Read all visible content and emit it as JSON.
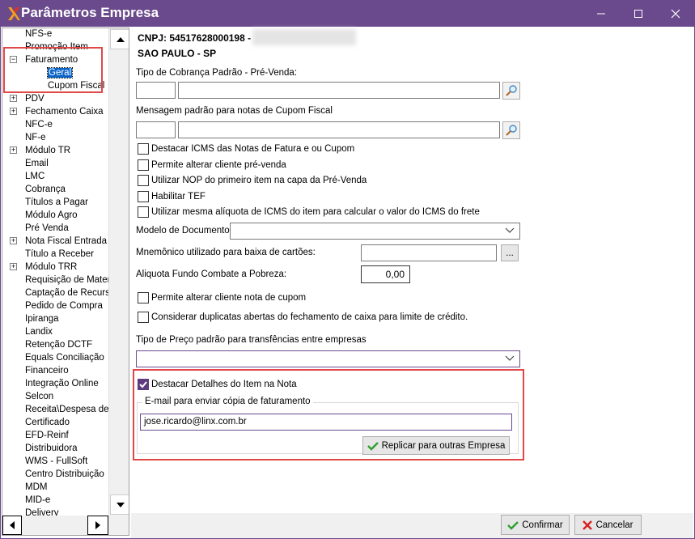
{
  "window": {
    "title": "Parâmetros Empresa"
  },
  "tree": {
    "items": [
      {
        "label": "NFS-e",
        "expander": ""
      },
      {
        "label": "Promoção Item",
        "expander": ""
      },
      {
        "label": "Faturamento",
        "expander": "−"
      },
      {
        "label": "Geral",
        "expander": "",
        "child": true,
        "selected": true
      },
      {
        "label": "Cupom Fiscal",
        "expander": "",
        "child": true
      },
      {
        "label": "PDV",
        "expander": "+"
      },
      {
        "label": "Fechamento Caixa",
        "expander": "+"
      },
      {
        "label": "NFC-e",
        "expander": ""
      },
      {
        "label": "NF-e",
        "expander": ""
      },
      {
        "label": "Módulo TR",
        "expander": "+"
      },
      {
        "label": "Email",
        "expander": ""
      },
      {
        "label": "LMC",
        "expander": ""
      },
      {
        "label": "Cobrança",
        "expander": ""
      },
      {
        "label": "Títulos a Pagar",
        "expander": ""
      },
      {
        "label": "Módulo Agro",
        "expander": ""
      },
      {
        "label": "Pré Venda",
        "expander": ""
      },
      {
        "label": "Nota Fiscal Entrada",
        "expander": "+"
      },
      {
        "label": "Título a Receber",
        "expander": ""
      },
      {
        "label": "Módulo TRR",
        "expander": "+"
      },
      {
        "label": "Requisição de Materia",
        "expander": ""
      },
      {
        "label": "Captação de Recurso",
        "expander": ""
      },
      {
        "label": "Pedido de Compra",
        "expander": ""
      },
      {
        "label": "Ipiranga",
        "expander": ""
      },
      {
        "label": "Landix",
        "expander": ""
      },
      {
        "label": "Retenção DCTF",
        "expander": ""
      },
      {
        "label": "Equals Conciliação",
        "expander": ""
      },
      {
        "label": "Financeiro",
        "expander": ""
      },
      {
        "label": "Integração Online",
        "expander": ""
      },
      {
        "label": "Selcon",
        "expander": ""
      },
      {
        "label": "Receita\\Despesa de T",
        "expander": ""
      },
      {
        "label": "Certificado",
        "expander": ""
      },
      {
        "label": "EFD-Reinf",
        "expander": ""
      },
      {
        "label": "Distribuidora",
        "expander": ""
      },
      {
        "label": "WMS - FullSoft",
        "expander": ""
      },
      {
        "label": "Centro Distribuição",
        "expander": ""
      },
      {
        "label": "MDM",
        "expander": ""
      },
      {
        "label": "MID-e",
        "expander": ""
      },
      {
        "label": "Delivery",
        "expander": ""
      }
    ]
  },
  "company": {
    "cnpj": "CNPJ: 54517628000198 -",
    "city": "SAO PAULO - SP"
  },
  "form": {
    "cobranca_label": "Tipo de Cobrança Padrão - Pré-Venda:",
    "mensagem_label": "Mensagem padrão para notas de Cupom Fiscal",
    "checks1": [
      {
        "label": "Destacar ICMS das Notas de Fatura e ou Cupom",
        "checked": false
      },
      {
        "label": "Permite alterar cliente pré-venda",
        "checked": false
      },
      {
        "label": "Utilizar NOP do primeiro item na capa da Pré-Venda",
        "checked": false
      },
      {
        "label": "Habilitar TEF",
        "checked": false
      },
      {
        "label": "Utilizar mesma alíquota de ICMS do item para calcular o valor do ICMS do frete",
        "checked": false
      }
    ],
    "modelo_label": "Modelo de Documento:",
    "mnemonico_label": "Mnemônico utilizado para baixa de cartões:",
    "mnemonico_btn": "...",
    "aliquota_label": "Aliquota Fundo Combate a Pobreza:",
    "aliquota_value": "0,00",
    "checks2": [
      {
        "label": "Permite alterar cliente nota de cupom",
        "checked": false
      },
      {
        "label": "Considerar duplicatas abertas do fechamento de caixa para limite de crédito.",
        "checked": false
      }
    ],
    "tipo_preco_label": "Tipo de Preço padrão para transfências entre empresas",
    "destacar_detalhes_label": "Destacar Detalhes do Item na Nota",
    "destacar_detalhes_checked": true,
    "email_group_label": "E-mail para enviar cópia de faturamento",
    "email_value": "jose.ricardo@linx.com.br",
    "replicar_label": "Replicar para outras Empresa"
  },
  "footer": {
    "confirmar": "Confirmar",
    "cancelar": "Cancelar"
  },
  "colors": {
    "titlebar": "#6a4a8c",
    "highlight_box": "#e04848",
    "selection": "#0a64c8"
  }
}
